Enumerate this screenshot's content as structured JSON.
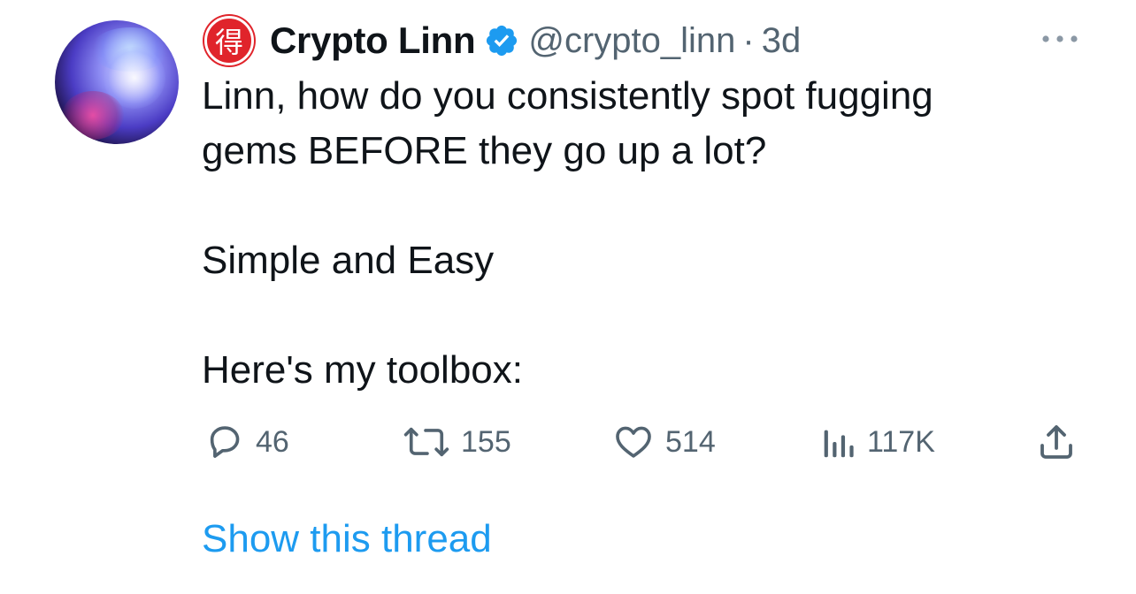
{
  "author": {
    "badge_glyph": "得",
    "display_name": "Crypto Linn",
    "handle": "@crypto_linn",
    "separator": "·",
    "timestamp": "3d",
    "verified": true,
    "badge_color": "#e0242b",
    "verified_color": "#1d9bf0"
  },
  "tweet": {
    "lines": [
      "Linn, how do you consistently spot fugging",
      "gems BEFORE they go up a lot?",
      "",
      "Simple and Easy",
      "",
      "Here's my toolbox:"
    ]
  },
  "actions": {
    "reply_count": "46",
    "retweet_count": "155",
    "like_count": "514",
    "view_count": "117K"
  },
  "footer": {
    "show_thread_label": "Show this thread"
  },
  "colors": {
    "text": "#0f1419",
    "secondary": "#536471",
    "link": "#1d9bf0"
  }
}
